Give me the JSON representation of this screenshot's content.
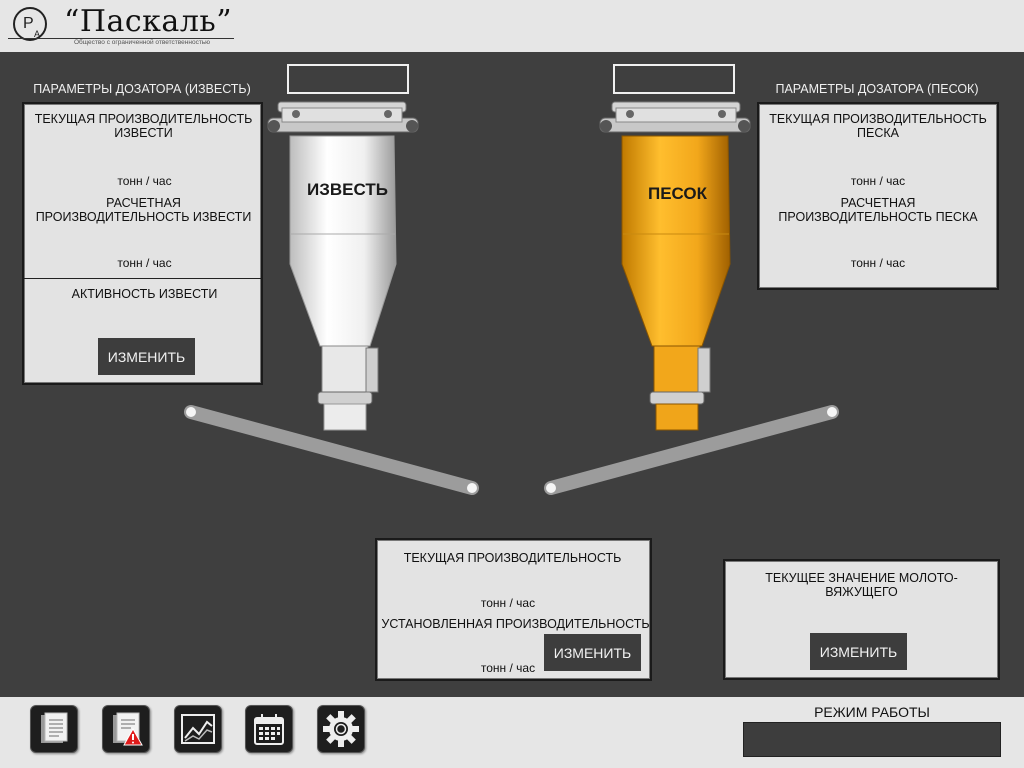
{
  "header": {
    "company_name": "“Паскаль”",
    "company_subtitle": "Общество с ограниченной ответственностью",
    "logo_letters": "РА"
  },
  "lime_doser": {
    "title": "ПАРАМЕТРЫ ДОЗАТОРА (ИЗВЕСТЬ)",
    "current_label": "ТЕКУЩАЯ ПРОИЗВОДИТЕЛЬНОСТЬ ИЗВЕСТИ",
    "current_unit": "тонн / час",
    "calc_label": "РАСЧЕТНАЯ ПРОИЗВОДИТЕЛЬНОСТЬ ИЗВЕСТИ",
    "calc_unit": "тонн / час",
    "activity_label": "АКТИВНОСТЬ ИЗВЕСТИ",
    "change_button": "ИЗМЕНИТЬ",
    "hopper_label": "ИЗВЕСТЬ",
    "hopper_value": ""
  },
  "sand_doser": {
    "title": "ПАРАМЕТРЫ ДОЗАТОРА (ПЕСОК)",
    "current_label": "ТЕКУЩАЯ ПРОИЗВОДИТЕЛЬНОСТЬ ПЕСКА",
    "current_unit": "тонн / час",
    "calc_label": "РАСЧЕТНАЯ ПРОИЗВОДИТЕЛЬНОСТЬ ПЕСКА",
    "calc_unit": "тонн / час",
    "hopper_label": "ПЕСОК",
    "hopper_value": ""
  },
  "total": {
    "current_label": "ТЕКУЩАЯ ПРОИЗВОДИТЕЛЬНОСТЬ",
    "current_unit": "тонн / час",
    "set_label": "УСТАНОВЛЕННАЯ ПРОИЗВОДИТЕЛЬНОСТЬ",
    "set_unit": "тонн / час",
    "change_button": "ИЗМЕНИТЬ"
  },
  "ratio": {
    "label": "ТЕКУЩЕЕ ЗНАЧЕНИЕ МОЛОТО-ВЯЖУЩЕГО",
    "change_button": "ИЗМЕНИТЬ"
  },
  "footer": {
    "buttons": [
      "report-icon",
      "alarm-report-icon",
      "trend-chart-icon",
      "calendar-icon",
      "settings-gear-icon"
    ],
    "mode_label": "РЕЖИМ РАБОТЫ",
    "mode_value": ""
  },
  "colors": {
    "background_dark": "#3f3f3f",
    "panel": "#e3e3e3",
    "button": "#3d3d3d",
    "sand_hopper": "#f2a71b",
    "lime_hopper": "#f2f2f2"
  }
}
